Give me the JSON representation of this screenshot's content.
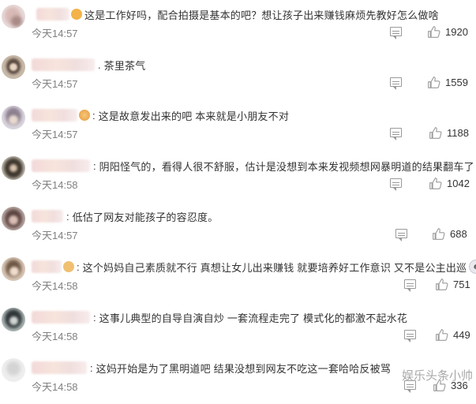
{
  "comments": [
    {
      "text": "这是工作好吗，配合拍摄是基本的吧？想让孩子出来赚钱麻烦先教好怎么做啥",
      "time": "今天14:57",
      "likes": "1920",
      "name_width": 42,
      "badge": "#f3b24a",
      "emoji": false
    },
    {
      "text": "茶里茶气",
      "time": "今天14:57",
      "likes": "1559",
      "name_width": 80,
      "badge": "",
      "emoji": false
    },
    {
      "text": "这是故意发出来的吧 本来就是小朋友不对",
      "time": "今天14:57",
      "likes": "1188",
      "name_width": 58,
      "badge": "#f2b15a",
      "emoji": false
    },
    {
      "text": "阴阳怪气的，看得人很不舒服，估计是没想到本来发视频想网暴明道的结果翻车了",
      "time": "今天14:58",
      "likes": "1042",
      "name_width": 74,
      "badge": "",
      "emoji": false
    },
    {
      "text": "低估了网友对能孩子的容忍度。",
      "time": "今天14:57",
      "likes": "688",
      "name_width": 40,
      "badge": "",
      "emoji": false
    },
    {
      "text": "这个妈妈自己素质就不行 真想让女儿出来赚钱 就要培养好工作意识 又不是公主出巡",
      "time": "今天14:58",
      "likes": "751",
      "name_width": 38,
      "badge": "#f0c070",
      "emoji": true
    },
    {
      "text": "这事儿典型的自导自演自炒 一套流程走完了 模式化的都激不起水花",
      "time": "今天14:58",
      "likes": "449",
      "name_width": 74,
      "badge": "",
      "emoji": false
    },
    {
      "text": "这妈开始是为了黑明道吧 结果没想到网友不吃这一套哈哈反被骂",
      "time": "今天14:58",
      "likes": "336",
      "name_width": 70,
      "badge": "",
      "emoji": false
    }
  ],
  "watermark": "娱乐头条小帅",
  "colors": {
    "time": "#808080",
    "text": "#333333",
    "icon": "#9a9a9a"
  }
}
